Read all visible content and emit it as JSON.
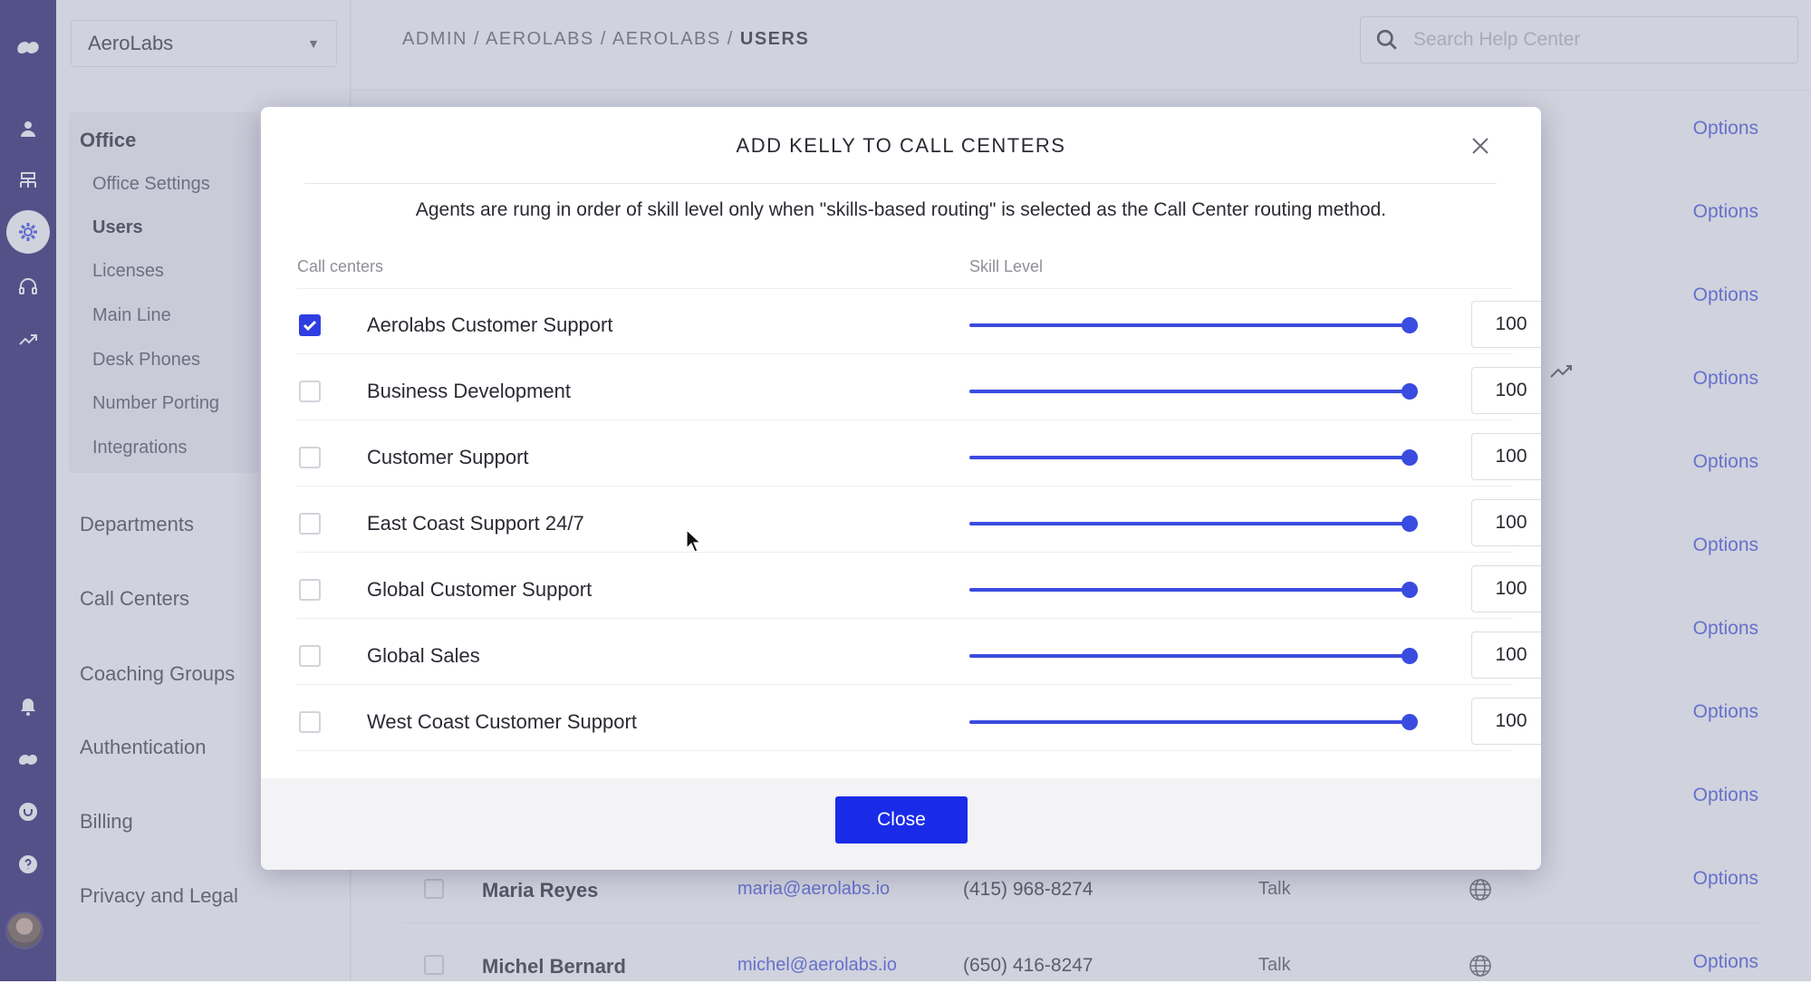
{
  "org_select": {
    "value": "AeroLabs"
  },
  "breadcrumb": {
    "prefix": "ADMIN / AEROLABS / AEROLABS / ",
    "current": "USERS"
  },
  "search": {
    "placeholder": "Search Help Center"
  },
  "sidebar": {
    "office_title": "Office",
    "office_items": [
      {
        "label": "Office Settings"
      },
      {
        "label": "Users"
      },
      {
        "label": "Licenses"
      },
      {
        "label": "Main Line"
      },
      {
        "label": "Desk Phones"
      },
      {
        "label": "Number Porting"
      },
      {
        "label": "Integrations"
      }
    ],
    "sections": [
      {
        "label": "Departments"
      },
      {
        "label": "Call Centers"
      },
      {
        "label": "Coaching Groups"
      },
      {
        "label": "Authentication"
      },
      {
        "label": "Billing"
      },
      {
        "label": "Privacy and Legal"
      }
    ]
  },
  "rail_icons": [
    "logo-icon",
    "user-icon",
    "org-icon",
    "settings-icon",
    "headset-icon",
    "analytics-icon",
    "bell-icon",
    "brand-icon",
    "shield-icon",
    "help-icon"
  ],
  "users_table": {
    "options_label": "Options",
    "rows": [
      {
        "name": "Maria Reyes",
        "email": "maria@aerolabs.io",
        "phone": "(415) 968-8274",
        "type": "Talk"
      },
      {
        "name": "Michel Bernard",
        "email": "michel@aerolabs.io",
        "phone": "(650) 416-8247",
        "type": "Talk"
      }
    ]
  },
  "modal": {
    "title": "ADD KELLY TO CALL CENTERS",
    "note": "Agents are rung in order of skill level only when \"skills-based routing\" is selected as the Call Center routing method.",
    "col_call_centers": "Call centers",
    "col_skill_level": "Skill Level",
    "skill_max": 100,
    "rows": [
      {
        "name": "Aerolabs Customer Support",
        "checked": true,
        "skill": "100"
      },
      {
        "name": "Business Development",
        "checked": false,
        "skill": "100"
      },
      {
        "name": "Customer Support",
        "checked": false,
        "skill": "100"
      },
      {
        "name": "East Coast Support 24/7",
        "checked": false,
        "skill": "100"
      },
      {
        "name": "Global Customer Support",
        "checked": false,
        "skill": "100"
      },
      {
        "name": "Global Sales",
        "checked": false,
        "skill": "100"
      },
      {
        "name": "West Coast Customer Support",
        "checked": false,
        "skill": "100"
      }
    ],
    "close_label": "Close"
  },
  "colors": {
    "brand_rail": "#1c1464",
    "accent": "#2e3ee0",
    "button": "#1a2be8"
  }
}
